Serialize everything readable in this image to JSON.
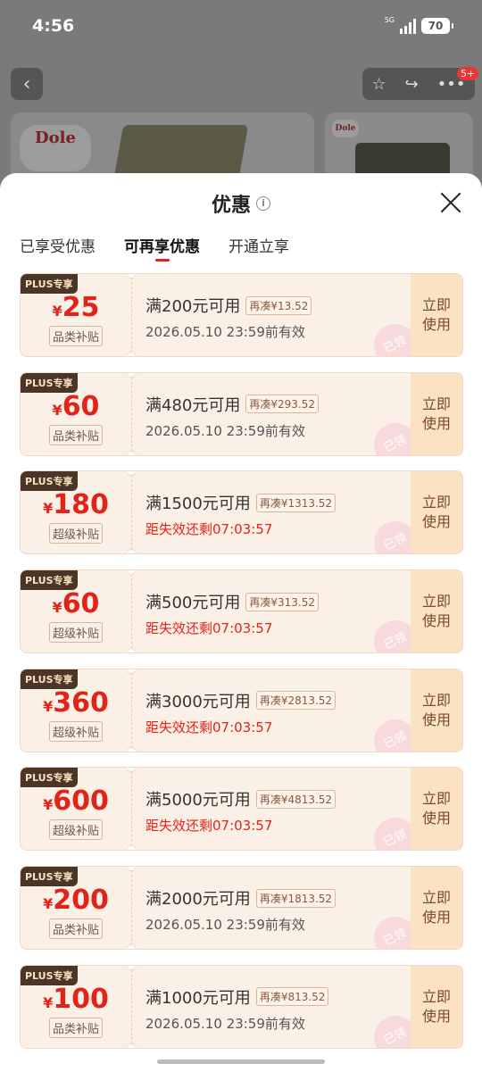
{
  "status": {
    "time": "4:56",
    "network": "5G",
    "battery": "70"
  },
  "header": {
    "badge": "5+"
  },
  "brand": {
    "logo": "Dole"
  },
  "sheet": {
    "title": "优惠",
    "tabs": [
      {
        "label": "已享受优惠"
      },
      {
        "label": "可再享优惠"
      },
      {
        "label": "开通立享"
      }
    ]
  },
  "coupons": [
    {
      "tag": "PLUS专享",
      "currency": "¥",
      "amount": "25",
      "category": "品类补贴",
      "condition": "满200元可用",
      "extra": "再凑¥13.52",
      "validity": "2026.05.10 23:59前有效",
      "validity_color": "gray",
      "stamp": "已领",
      "action": "立即使用"
    },
    {
      "tag": "PLUS专享",
      "currency": "¥",
      "amount": "60",
      "category": "品类补贴",
      "condition": "满480元可用",
      "extra": "再凑¥293.52",
      "validity": "2026.05.10 23:59前有效",
      "validity_color": "gray",
      "stamp": "已领",
      "action": "立即使用"
    },
    {
      "tag": "PLUS专享",
      "currency": "¥",
      "amount": "180",
      "category": "超级补贴",
      "condition": "满1500元可用",
      "extra": "再凑¥1313.52",
      "validity": "距失效还剩07:03:57",
      "validity_color": "red",
      "stamp": "已领",
      "action": "立即使用"
    },
    {
      "tag": "PLUS专享",
      "currency": "¥",
      "amount": "60",
      "category": "超级补贴",
      "condition": "满500元可用",
      "extra": "再凑¥313.52",
      "validity": "距失效还剩07:03:57",
      "validity_color": "red",
      "stamp": "已领",
      "action": "立即使用"
    },
    {
      "tag": "PLUS专享",
      "currency": "¥",
      "amount": "360",
      "category": "超级补贴",
      "condition": "满3000元可用",
      "extra": "再凑¥2813.52",
      "validity": "距失效还剩07:03:57",
      "validity_color": "red",
      "stamp": "已领",
      "action": "立即使用"
    },
    {
      "tag": "PLUS专享",
      "currency": "¥",
      "amount": "600",
      "category": "超级补贴",
      "condition": "满5000元可用",
      "extra": "再凑¥4813.52",
      "validity": "距失效还剩07:03:57",
      "validity_color": "red",
      "stamp": "已领",
      "action": "立即使用"
    },
    {
      "tag": "PLUS专享",
      "currency": "¥",
      "amount": "200",
      "category": "品类补贴",
      "condition": "满2000元可用",
      "extra": "再凑¥1813.52",
      "validity": "2026.05.10 23:59前有效",
      "validity_color": "gray",
      "stamp": "已领",
      "action": "立即使用"
    },
    {
      "tag": "PLUS专享",
      "currency": "¥",
      "amount": "100",
      "category": "品类补贴",
      "condition": "满1000元可用",
      "extra": "再凑¥813.52",
      "validity": "2026.05.10 23:59前有效",
      "validity_color": "gray",
      "stamp": "已领",
      "action": "立即使用"
    }
  ],
  "colors": {
    "accent": "#e2231a",
    "plus_tag_bg": "#4a3527",
    "coupon_bg": "#fbf0e6",
    "action_bg": "#fbe2c2"
  }
}
